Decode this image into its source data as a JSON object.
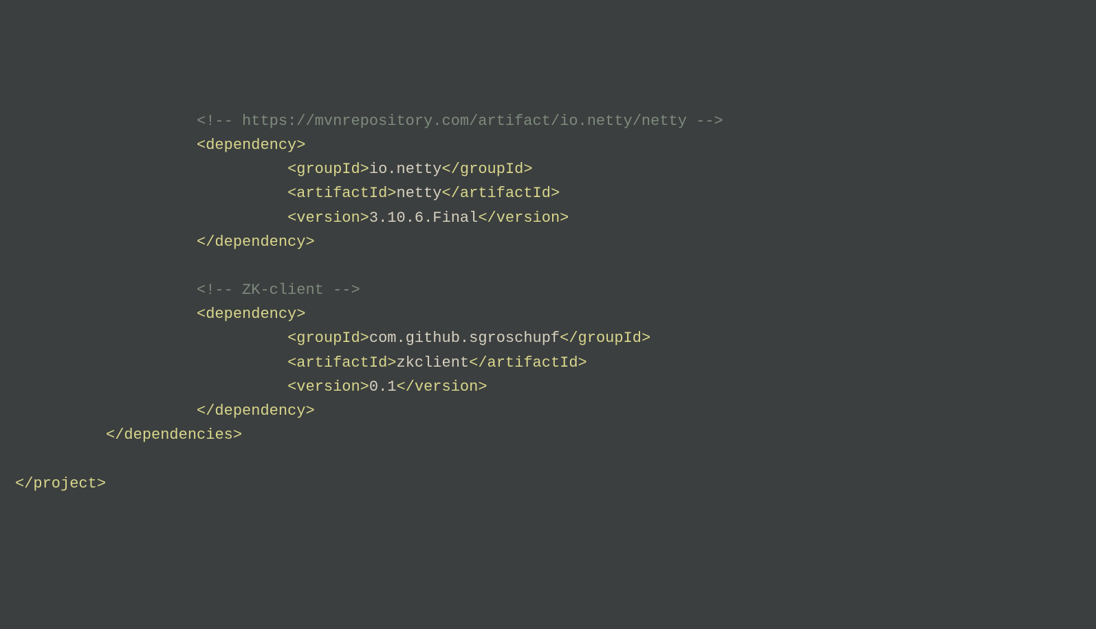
{
  "lines": [
    {
      "indent": "ind3",
      "segs": [
        {
          "cls": "comment",
          "t": "<!-- https://mvnrepository.com/artifact/io.netty/netty -->"
        }
      ]
    },
    {
      "indent": "ind3",
      "segs": [
        {
          "cls": "tag",
          "t": "<dependency>"
        }
      ]
    },
    {
      "indent": "ind4",
      "segs": [
        {
          "cls": "tag",
          "t": "<groupId>"
        },
        {
          "cls": "text",
          "t": "io.netty"
        },
        {
          "cls": "tag",
          "t": "</groupId>"
        }
      ]
    },
    {
      "indent": "ind4",
      "segs": [
        {
          "cls": "tag",
          "t": "<artifactId>"
        },
        {
          "cls": "text",
          "t": "netty"
        },
        {
          "cls": "tag",
          "t": "</artifactId>"
        }
      ]
    },
    {
      "indent": "ind4",
      "segs": [
        {
          "cls": "tag",
          "t": "<version>"
        },
        {
          "cls": "text",
          "t": "3.10.6.Final"
        },
        {
          "cls": "tag",
          "t": "</version>"
        }
      ]
    },
    {
      "indent": "ind3",
      "segs": [
        {
          "cls": "tag",
          "t": "</dependency>"
        }
      ]
    },
    {
      "indent": "ind3",
      "segs": [
        {
          "cls": "text",
          "t": " "
        }
      ]
    },
    {
      "indent": "ind3",
      "segs": [
        {
          "cls": "comment",
          "t": "<!-- ZK-client -->"
        }
      ]
    },
    {
      "indent": "ind3",
      "segs": [
        {
          "cls": "tag",
          "t": "<dependency>"
        }
      ]
    },
    {
      "indent": "ind4",
      "segs": [
        {
          "cls": "tag",
          "t": "<groupId>"
        },
        {
          "cls": "text",
          "t": "com.github.sgroschupf"
        },
        {
          "cls": "tag",
          "t": "</groupId>"
        }
      ]
    },
    {
      "indent": "ind4",
      "segs": [
        {
          "cls": "tag",
          "t": "<artifactId>"
        },
        {
          "cls": "text",
          "t": "zkclient"
        },
        {
          "cls": "tag",
          "t": "</artifactId>"
        }
      ]
    },
    {
      "indent": "ind4",
      "segs": [
        {
          "cls": "tag",
          "t": "<version>"
        },
        {
          "cls": "text",
          "t": "0.1"
        },
        {
          "cls": "tag",
          "t": "</version>"
        }
      ]
    },
    {
      "indent": "ind3",
      "segs": [
        {
          "cls": "tag",
          "t": "</dependency>"
        }
      ]
    },
    {
      "indent": "ind2",
      "segs": [
        {
          "cls": "tag",
          "t": "</dependencies>"
        }
      ]
    },
    {
      "indent": "ind1",
      "segs": [
        {
          "cls": "text",
          "t": " "
        }
      ]
    },
    {
      "indent": "ind1",
      "segs": [
        {
          "cls": "tag",
          "t": "</project>"
        }
      ]
    }
  ]
}
